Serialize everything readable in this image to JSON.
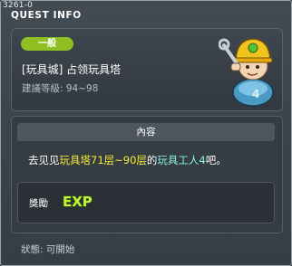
{
  "header": {
    "quest_id": "3261-0",
    "title": "QUEST INFO"
  },
  "quest": {
    "category": "一般",
    "name": "[玩具城] 占领玩具塔",
    "recommended_level": "建議等級: 94~98"
  },
  "content": {
    "section_title": "內容",
    "description_parts": {
      "p1": "去见见",
      "p2": "玩具塔71层~90层",
      "p3": "的",
      "p4": "玩具工人4",
      "p5": "吧。"
    }
  },
  "reward": {
    "label": "獎勵",
    "icon": "exp-icon",
    "icon_text": "EXP"
  },
  "status": {
    "text": "狀態: 可開始"
  },
  "colors": {
    "badge": "#8fbf22",
    "highlight_yellow": "#f3ea37",
    "highlight_cyan": "#86f1e9",
    "exp_fill": "#c6f33a"
  }
}
